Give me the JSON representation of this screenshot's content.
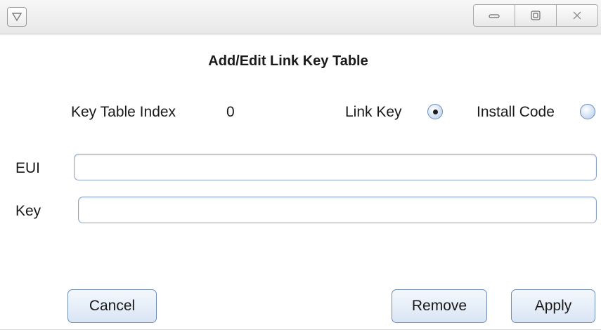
{
  "window": {
    "system_menu_icon": "triangle-down-icon",
    "minimize_icon": "minimize-icon",
    "maximize_icon": "maximize-icon",
    "close_icon": "close-icon"
  },
  "dialog": {
    "title": "Add/Edit Link Key Table"
  },
  "index": {
    "label": "Key Table Index",
    "value": "0"
  },
  "key_type": {
    "link_key_label": "Link Key",
    "install_code_label": "Install Code",
    "selected": "Link Key"
  },
  "eui": {
    "label": "EUI",
    "value": ""
  },
  "key": {
    "label": "Key",
    "value": ""
  },
  "buttons": {
    "cancel": "Cancel",
    "remove": "Remove",
    "apply": "Apply"
  },
  "colors": {
    "button_border": "#6f8cb3",
    "field_border": "#8aa4c8",
    "radio_fill": "#c9daf0"
  }
}
